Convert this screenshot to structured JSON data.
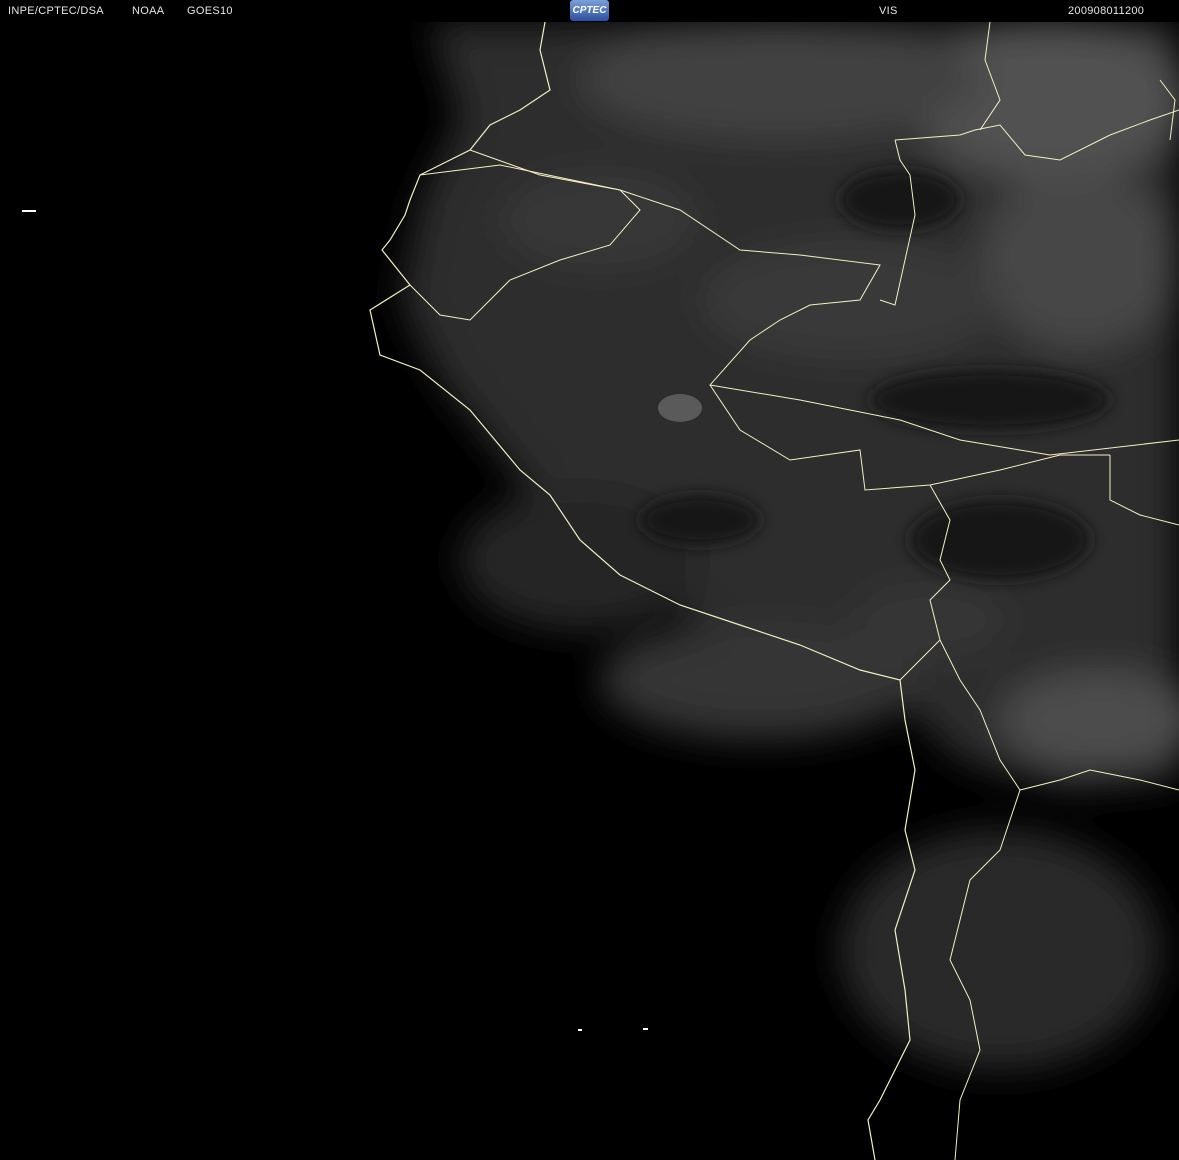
{
  "header": {
    "agency": "INPE/CPTEC/DSA",
    "source": "NOAA",
    "satellite": "GOES10",
    "logo": "CPTEC",
    "channel": "VIS",
    "timestamp": "200908011200"
  },
  "colors": {
    "background": "#000000",
    "borders": "#f2f0c0",
    "clouds": "#6a6a6a"
  }
}
